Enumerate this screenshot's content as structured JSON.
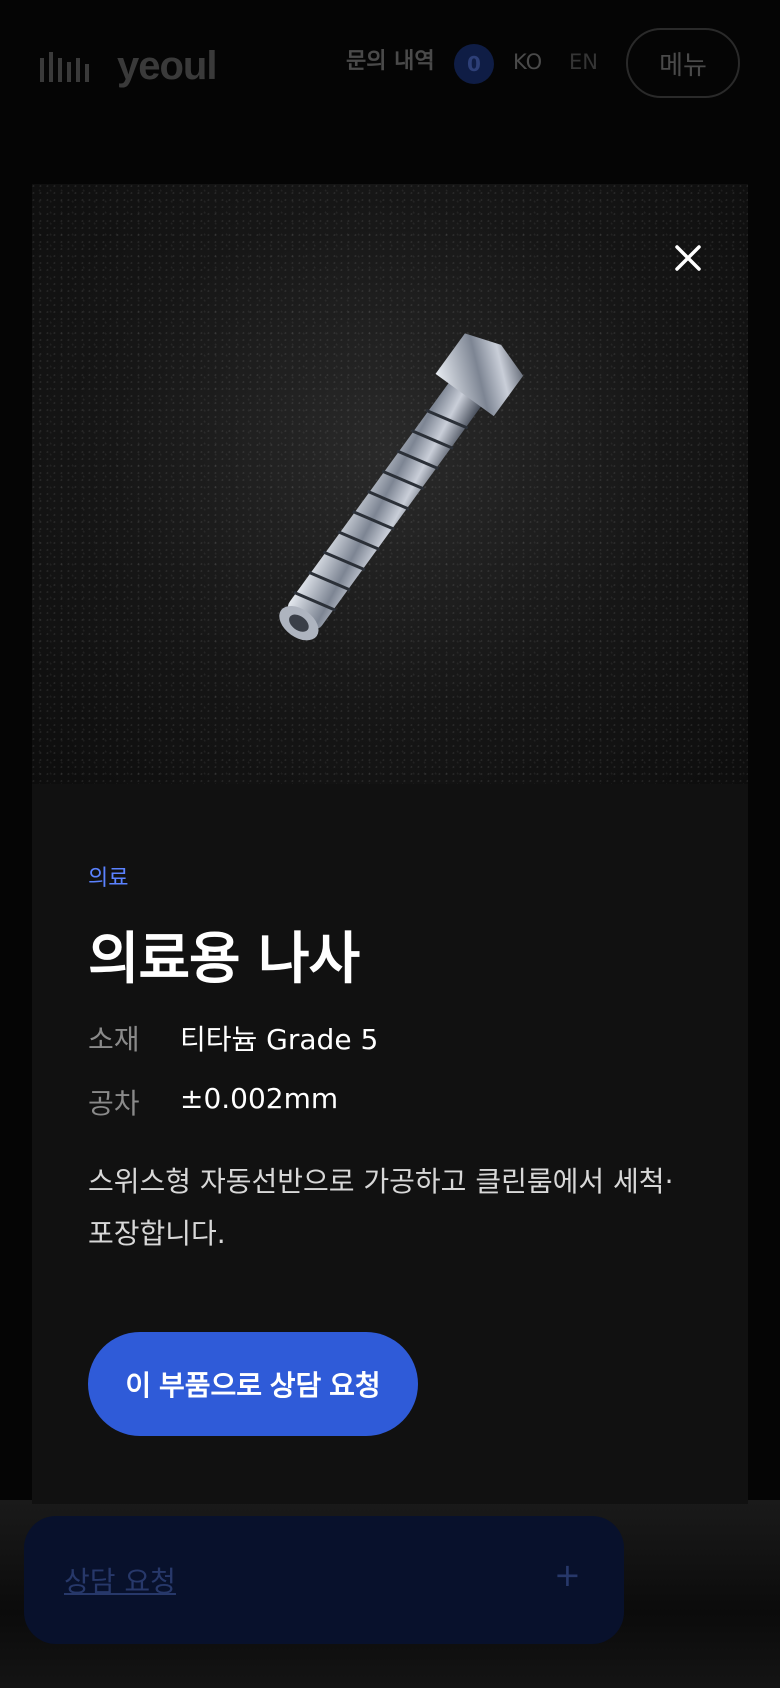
{
  "header": {
    "logo_text": "yeoul",
    "inquiry_label": "문의 내역",
    "inquiry_count": "0",
    "lang_ko": "KO",
    "lang_en": "EN",
    "menu_label": "메뉴"
  },
  "modal": {
    "close_icon": "close-icon",
    "image": "medical-screw-photo",
    "category": "의료",
    "title": "의료용 나사",
    "specs": [
      {
        "label": "소재",
        "value": "티타늄 Grade 5"
      },
      {
        "label": "공차",
        "value": "±0.002mm"
      }
    ],
    "description": "스위스형 자동선반으로 가공하고 클린룸에서 세척·포장합니다.",
    "cta_label": "이 부품으로 상담 요청"
  },
  "consult_bar": {
    "label": "상담 요청",
    "expand_icon": "plus-icon"
  },
  "colors": {
    "accent": "#2f5bd8",
    "category": "#5b82ff",
    "modal_bg": "#111111"
  }
}
